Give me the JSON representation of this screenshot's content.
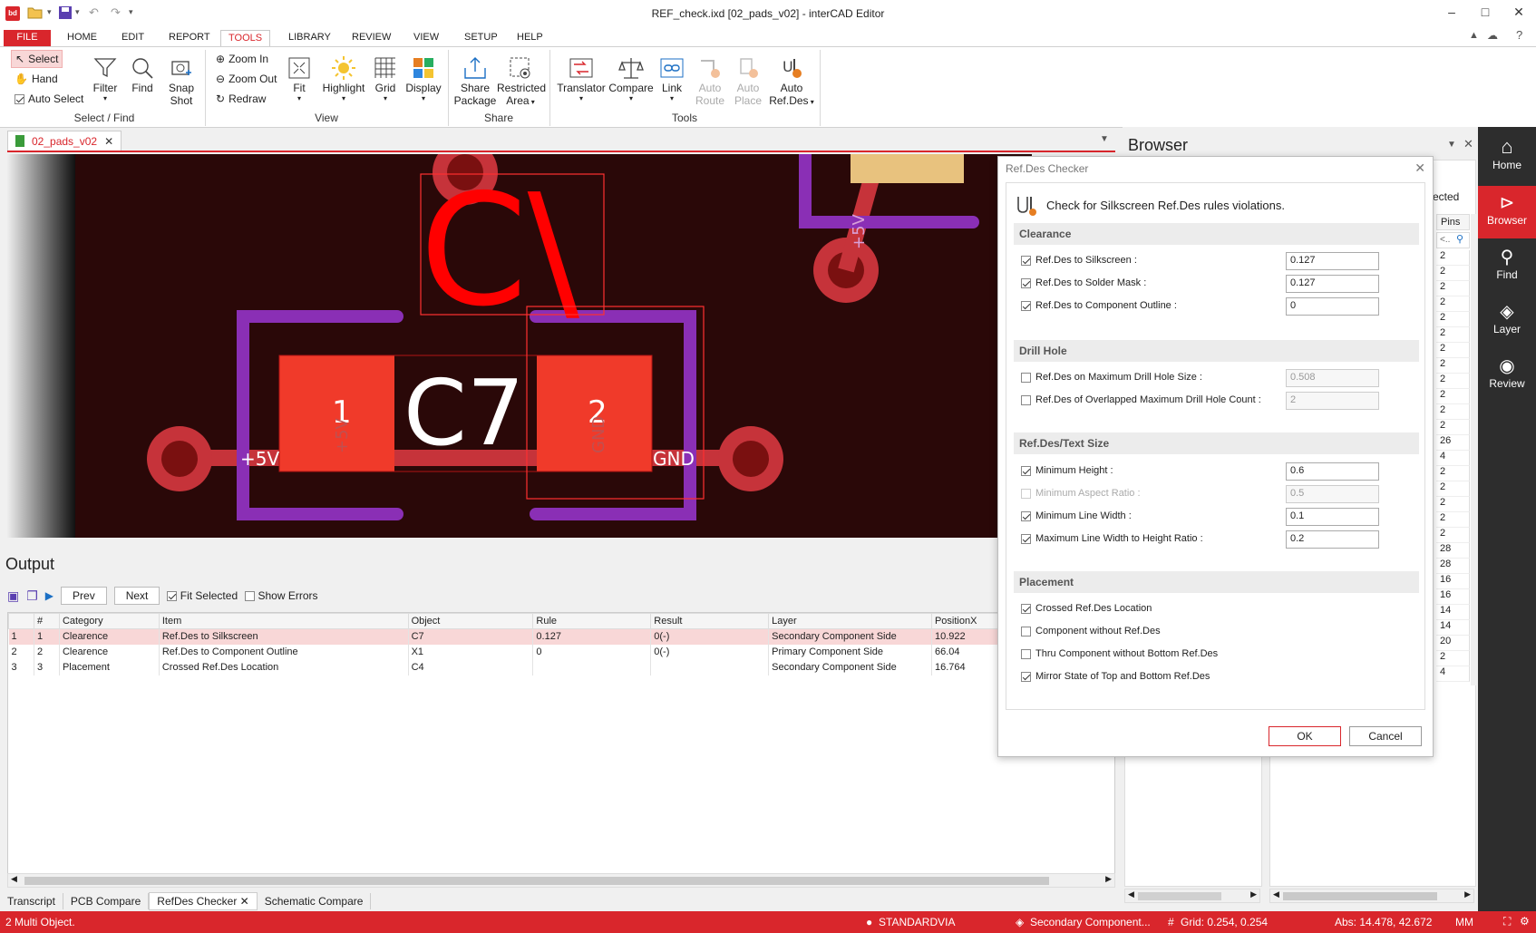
{
  "window": {
    "title": "REF_check.ixd [02_pads_v02] - interCAD Editor",
    "logo": "bd",
    "min": "–",
    "max": "□",
    "close": "✕",
    "quick_icons": [
      "open-icon",
      "save-icon",
      "undo-icon",
      "redo-icon"
    ]
  },
  "menu": {
    "items": [
      "FILE",
      "HOME",
      "EDIT",
      "REPORT",
      "TOOLS",
      "LIBRARY",
      "REVIEW",
      "VIEW",
      "SETUP",
      "HELP"
    ]
  },
  "ribbon": {
    "select_find": {
      "select": "Select",
      "hand": "Hand",
      "auto_select": "Auto Select",
      "filter": "Filter",
      "find": "Find",
      "snapshot_1": "Snap",
      "snapshot_2": "Shot",
      "label": "Select / Find"
    },
    "view": {
      "zoom_in": "Zoom In",
      "zoom_out": "Zoom Out",
      "redraw": "Redraw",
      "fit": "Fit",
      "highlight": "Highlight",
      "grid": "Grid",
      "display": "Display",
      "label": "View"
    },
    "share": {
      "share_package_1": "Share",
      "share_package_2": "Package",
      "restricted_area_1": "Restricted",
      "restricted_area_2": "Area",
      "label": "Share"
    },
    "tools": {
      "translator": "Translator",
      "compare": "Compare",
      "link": "Link",
      "auto_route_1": "Auto",
      "auto_route_2": "Route",
      "auto_place_1": "Auto",
      "auto_place_2": "Place",
      "auto_refdes_1": "Auto",
      "auto_refdes_2": "Ref.Des",
      "label": "Tools"
    }
  },
  "doc_tab": {
    "label": "02_pads_v02",
    "close": "✕"
  },
  "canvas": {
    "pad1": "1",
    "pad2": "2",
    "refdes": "C7",
    "ghost_refdes": "C\\",
    "net_5v": "+5V",
    "net_gnd": "GND",
    "net_5v_vertical": "+5V",
    "pad1_net": "+5V",
    "pad2_net": "GND"
  },
  "browser": {
    "title": "Browser",
    "partial_label": "ected",
    "pins_header": "Pins",
    "filter_placeholder": "<..",
    "pins": [
      "2",
      "2",
      "2",
      "2",
      "2",
      "2",
      "2",
      "2",
      "2",
      "2",
      "2",
      "2",
      "26",
      "4",
      "2",
      "2",
      "2",
      "2",
      "2",
      "28",
      "28",
      "16",
      "16",
      "14",
      "14",
      "20",
      "2",
      "4"
    ]
  },
  "right_rail": {
    "items": [
      {
        "label": "Home",
        "icon": "home-icon"
      },
      {
        "label": "Browser",
        "icon": "browser-icon"
      },
      {
        "label": "Find",
        "icon": "search-icon"
      },
      {
        "label": "Layer",
        "icon": "layers-icon"
      },
      {
        "label": "Review",
        "icon": "review-icon"
      }
    ]
  },
  "output": {
    "title": "Output",
    "prev": "Prev",
    "next": "Next",
    "fit_selected": "Fit Selected",
    "show_errors": "Show Errors",
    "columns": [
      "",
      "#",
      "Category",
      "Item",
      "Object",
      "Rule",
      "Result",
      "Layer",
      "PositionX"
    ],
    "rows": [
      [
        "1",
        "1",
        "Clearence",
        "Ref.Des to Silkscreen",
        "C7",
        "0.127",
        "0(-)",
        "Secondary Component Side",
        "10.922"
      ],
      [
        "2",
        "2",
        "Clearence",
        "Ref.Des to Component Outline",
        "X1",
        "0",
        "0(-)",
        "Primary Component Side",
        "66.04"
      ],
      [
        "3",
        "3",
        "Placement",
        "Crossed Ref.Des Location",
        "C4",
        "",
        "",
        "Secondary Component Side",
        "16.764"
      ]
    ]
  },
  "bottom_tabs": [
    "Transcript",
    "PCB Compare",
    "RefDes Checker",
    "Schematic Compare"
  ],
  "dialog": {
    "title": "Ref.Des Checker",
    "heading": "Check for Silkscreen Ref.Des rules violations.",
    "clearance": {
      "header": "Clearance",
      "silkscreen": {
        "label": "Ref.Des to Silkscreen :",
        "value": "0.127"
      },
      "solder_mask": {
        "label": "Ref.Des to Solder Mask :",
        "value": "0.127"
      },
      "component_outline": {
        "label": "Ref.Des to Component Outline :",
        "value": "0"
      }
    },
    "drill": {
      "header": "Drill Hole",
      "max_size": {
        "label": "Ref.Des on Maximum Drill Hole Size :",
        "value": "0.508"
      },
      "overlapped": {
        "label": "Ref.Des of Overlapped Maximum Drill Hole Count :",
        "value": "2"
      }
    },
    "text_size": {
      "header": "Ref.Des/Text Size",
      "min_height": {
        "label": "Minimum Height :",
        "value": "0.6"
      },
      "min_aspect": {
        "label": "Minimum Aspect Ratio :",
        "value": "0.5"
      },
      "min_line_width": {
        "label": "Minimum Line Width :",
        "value": "0.1"
      },
      "max_ratio": {
        "label": "Maximum Line Width to Height Ratio :",
        "value": "0.2"
      }
    },
    "placement": {
      "header": "Placement",
      "crossed": "Crossed Ref.Des Location",
      "without_refdes": "Component without Ref.Des",
      "thru_without_bottom": "Thru Component without Bottom Ref.Des",
      "mirror_state": "Mirror State of Top and Bottom Ref.Des"
    },
    "ok": "OK",
    "cancel": "Cancel",
    "close": "✕"
  },
  "status": {
    "left": "2 Multi Object.",
    "via": "STANDARDVIA",
    "layer": "Secondary Component...",
    "grid": "Grid: 0.254, 0.254",
    "abs": "Abs: 14.478, 42.672",
    "unit": "MM"
  },
  "colors": {
    "accent": "#d9262c",
    "pcb_background": "#2a0808",
    "silkscreen_outline": "#8a2fb5",
    "pad": "#f03a2a"
  }
}
